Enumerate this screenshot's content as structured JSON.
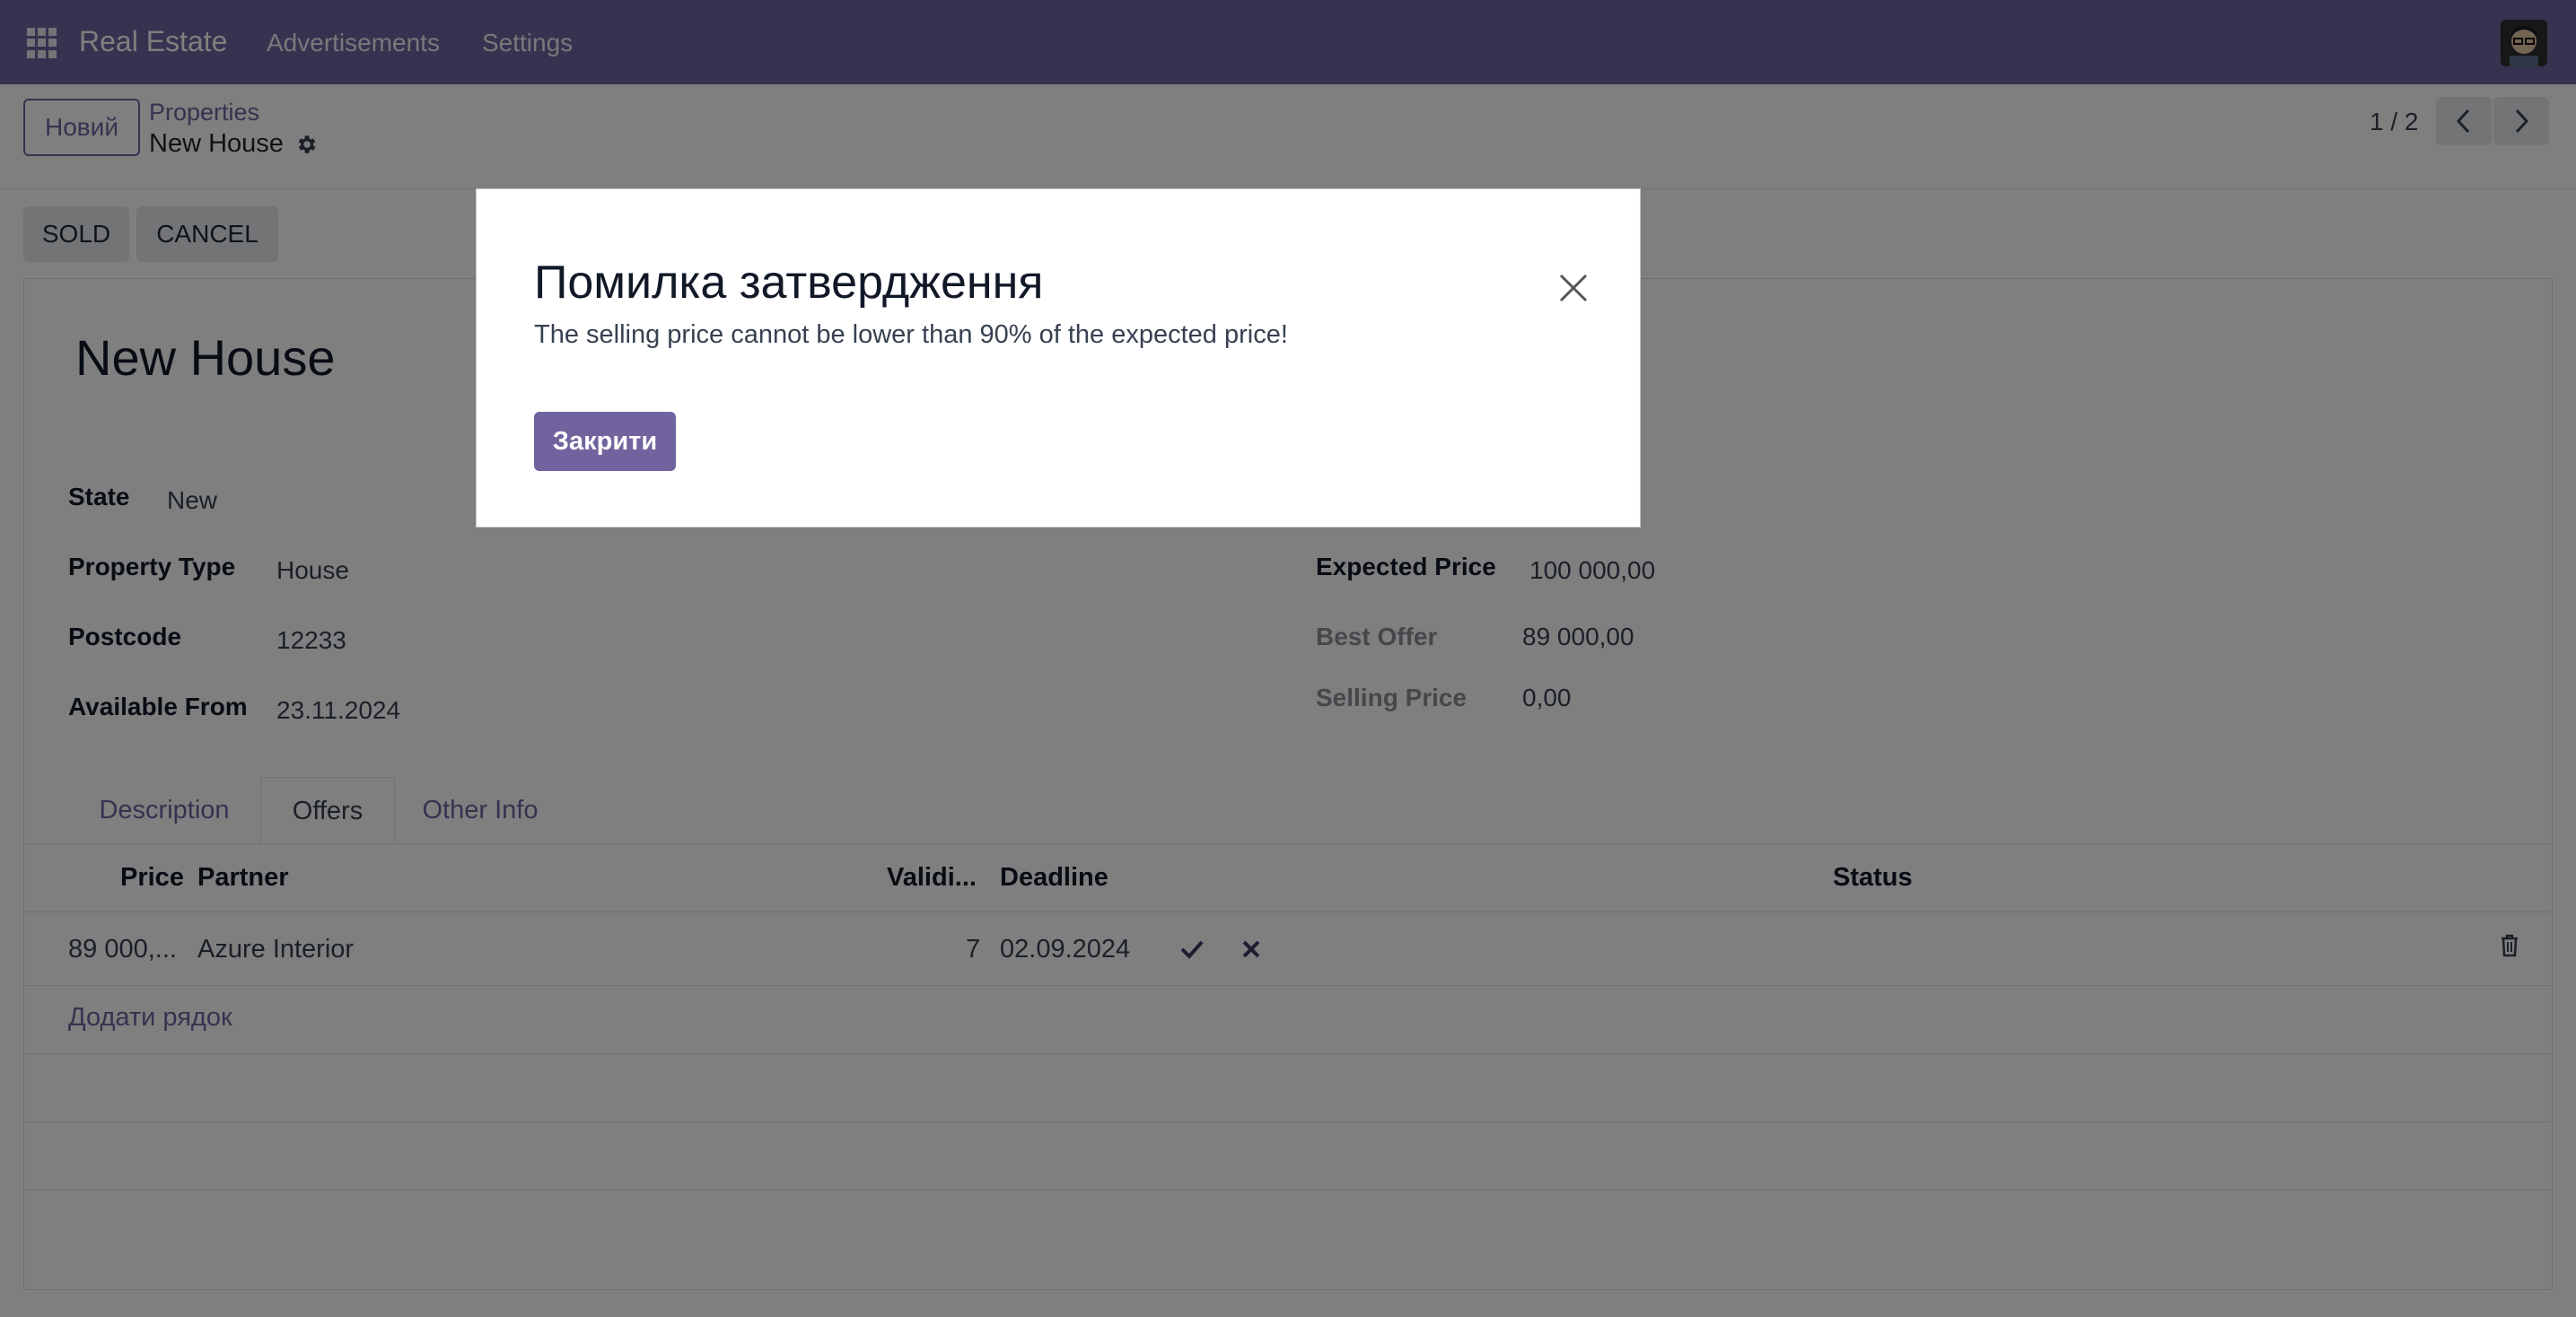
{
  "navbar": {
    "brand": "Real Estate",
    "links": [
      "Advertisements",
      "Settings"
    ]
  },
  "control": {
    "new_button": "Новий",
    "breadcrumb_parent": "Properties",
    "breadcrumb_current": "New House",
    "pager": "1 / 2"
  },
  "status_buttons": [
    "SOLD",
    "CANCEL"
  ],
  "record": {
    "title": "New House",
    "state_label": "State",
    "state_value": "New",
    "property_type_label": "Property Type",
    "property_type_value": "House",
    "postcode_label": "Postcode",
    "postcode_value": "12233",
    "available_from_label": "Available From",
    "available_from_value": "23.11.2024",
    "expected_price_label": "Expected Price",
    "expected_price_value": "100 000,00",
    "best_offer_label": "Best Offer",
    "best_offer_value": "89 000,00",
    "selling_price_label": "Selling Price",
    "selling_price_value": "0,00"
  },
  "tabs": [
    "Description",
    "Offers",
    "Other Info"
  ],
  "offers": {
    "columns": [
      "Price",
      "Partner",
      "Validi...",
      "Deadline",
      "Status"
    ],
    "rows": [
      {
        "price": "89 000,...",
        "partner": "Azure Interior",
        "validity": "7",
        "deadline": "02.09.2024"
      }
    ],
    "add_line": "Додати рядок"
  },
  "dialog": {
    "title": "Помилка затвердження",
    "message": "The selling price cannot be lower than 90% of the expected price!",
    "close_button": "Закрити"
  },
  "colors": {
    "brand": "#71639e",
    "navbar": "#71639e"
  }
}
